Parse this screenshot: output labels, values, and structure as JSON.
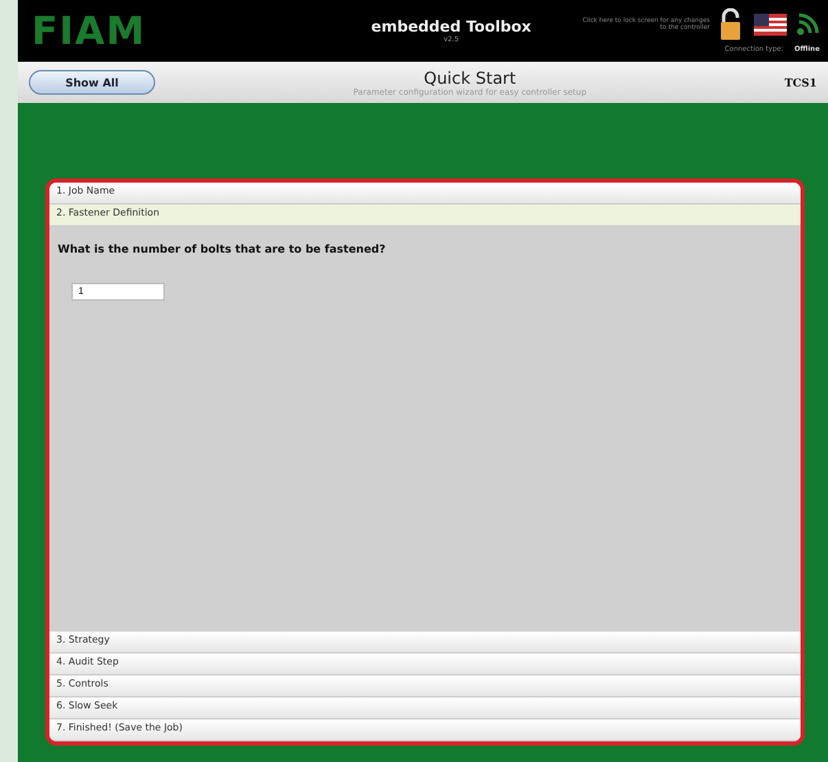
{
  "header": {
    "logo": "FIAM",
    "title": "embedded Toolbox",
    "version": "v2.5",
    "lock_hint": [
      "Click here to lock screen for any changes",
      "to the controller"
    ],
    "connection_label": "Connection type:",
    "connection_value": "Offline"
  },
  "title_bar": {
    "button": "Show All",
    "title": "Quick Start",
    "subtitle": "Parameter configuration wizard for easy controller setup",
    "device": "TCS1"
  },
  "steps": [
    {
      "label": "1. Job Name",
      "selected": false
    },
    {
      "label": "2. Fastener Definition",
      "selected": true
    },
    {
      "label": "3. Strategy",
      "selected": false
    },
    {
      "label": "4. Audit Step",
      "selected": false
    },
    {
      "label": "5. Controls",
      "selected": false
    },
    {
      "label": "6. Slow Seek",
      "selected": false
    },
    {
      "label": "7. Finished! (Save the Job)",
      "selected": false
    }
  ],
  "content": {
    "question": "What is the number of bolts that are to be fastened?",
    "value": "1"
  }
}
